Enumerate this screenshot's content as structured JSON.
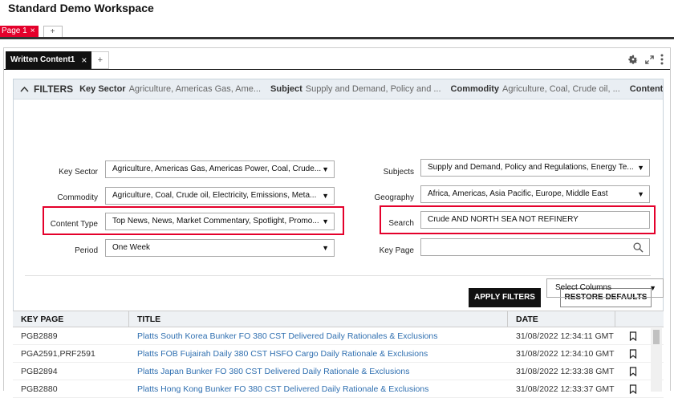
{
  "app": {
    "title": "Standard Demo Workspace"
  },
  "page_tabs": {
    "active": "Page 1",
    "close": "×",
    "add": "+"
  },
  "workspace": {
    "tab_active": "Written Content1",
    "tab_close": "×",
    "tab_add": "+",
    "tools": [
      "gear-icon",
      "expand-icon",
      "more-vertical-icon"
    ]
  },
  "filters": {
    "toggle": "^",
    "title": "FILTERS",
    "summary": [
      {
        "key": "Key Sector",
        "value": "Agriculture, Americas Gas, Ame..."
      },
      {
        "key": "Subject",
        "value": "Supply and Demand, Policy and ..."
      },
      {
        "key": "Commodity",
        "value": "Agriculture, Coal, Crude oil, ..."
      },
      {
        "key": "Content Ty",
        "value": ""
      }
    ],
    "fields": {
      "key_sector": {
        "label": "Key Sector",
        "value": "Agriculture, Americas Gas, Americas Power, Coal, Crude..."
      },
      "commodity": {
        "label": "Commodity",
        "value": "Agriculture, Coal, Crude oil, Electricity, Emissions, Meta..."
      },
      "content_type": {
        "label": "Content Type",
        "value": "Top News, News, Market Commentary, Spotlight, Promo..."
      },
      "period": {
        "label": "Period",
        "value": "One Week"
      },
      "subjects": {
        "label": "Subjects",
        "value": "Supply and Demand, Policy and Regulations, Energy Te..."
      },
      "geography": {
        "label": "Geography",
        "value": "Africa, Americas, Asia Pacific, Europe, Middle East"
      },
      "search": {
        "label": "Search",
        "value": "Crude AND NORTH SEA NOT REFINERY"
      },
      "key_page": {
        "label": "Key Page",
        "value": ""
      }
    },
    "apply_label": "APPLY FILTERS",
    "restore_label": "RESTORE DEFAULTS",
    "highlight_color": "#e4002b"
  },
  "select_columns": {
    "label": "Select Columns"
  },
  "table": {
    "headers": [
      "KEY PAGE",
      "TITLE",
      "DATE"
    ],
    "rows": [
      {
        "key_page": "PGB2889",
        "title": "Platts South Korea Bunker FO 380 CST Delivered Daily Rationales & Exclusions",
        "date": "31/08/2022 12:34:11 GMT"
      },
      {
        "key_page": "PGA2591,PRF2591",
        "title": "Platts FOB Fujairah Daily 380 CST HSFO Cargo Daily Rationale & Exclusions",
        "date": "31/08/2022 12:34:10 GMT"
      },
      {
        "key_page": "PGB2894",
        "title": "Platts Japan Bunker FO 380 CST Delivered Daily Rationale & Exclusions",
        "date": "31/08/2022 12:33:38 GMT"
      },
      {
        "key_page": "PGB2880",
        "title": "Platts Hong Kong Bunker FO 380 CST Delivered Daily Rationale & Exclusions",
        "date": "31/08/2022 12:33:37 GMT"
      }
    ]
  },
  "colors": {
    "link": "#2f6fb0",
    "accent": "#e4002b",
    "header_bg": "#eef1f4",
    "filter_bar_bg": "#e9eef3"
  }
}
